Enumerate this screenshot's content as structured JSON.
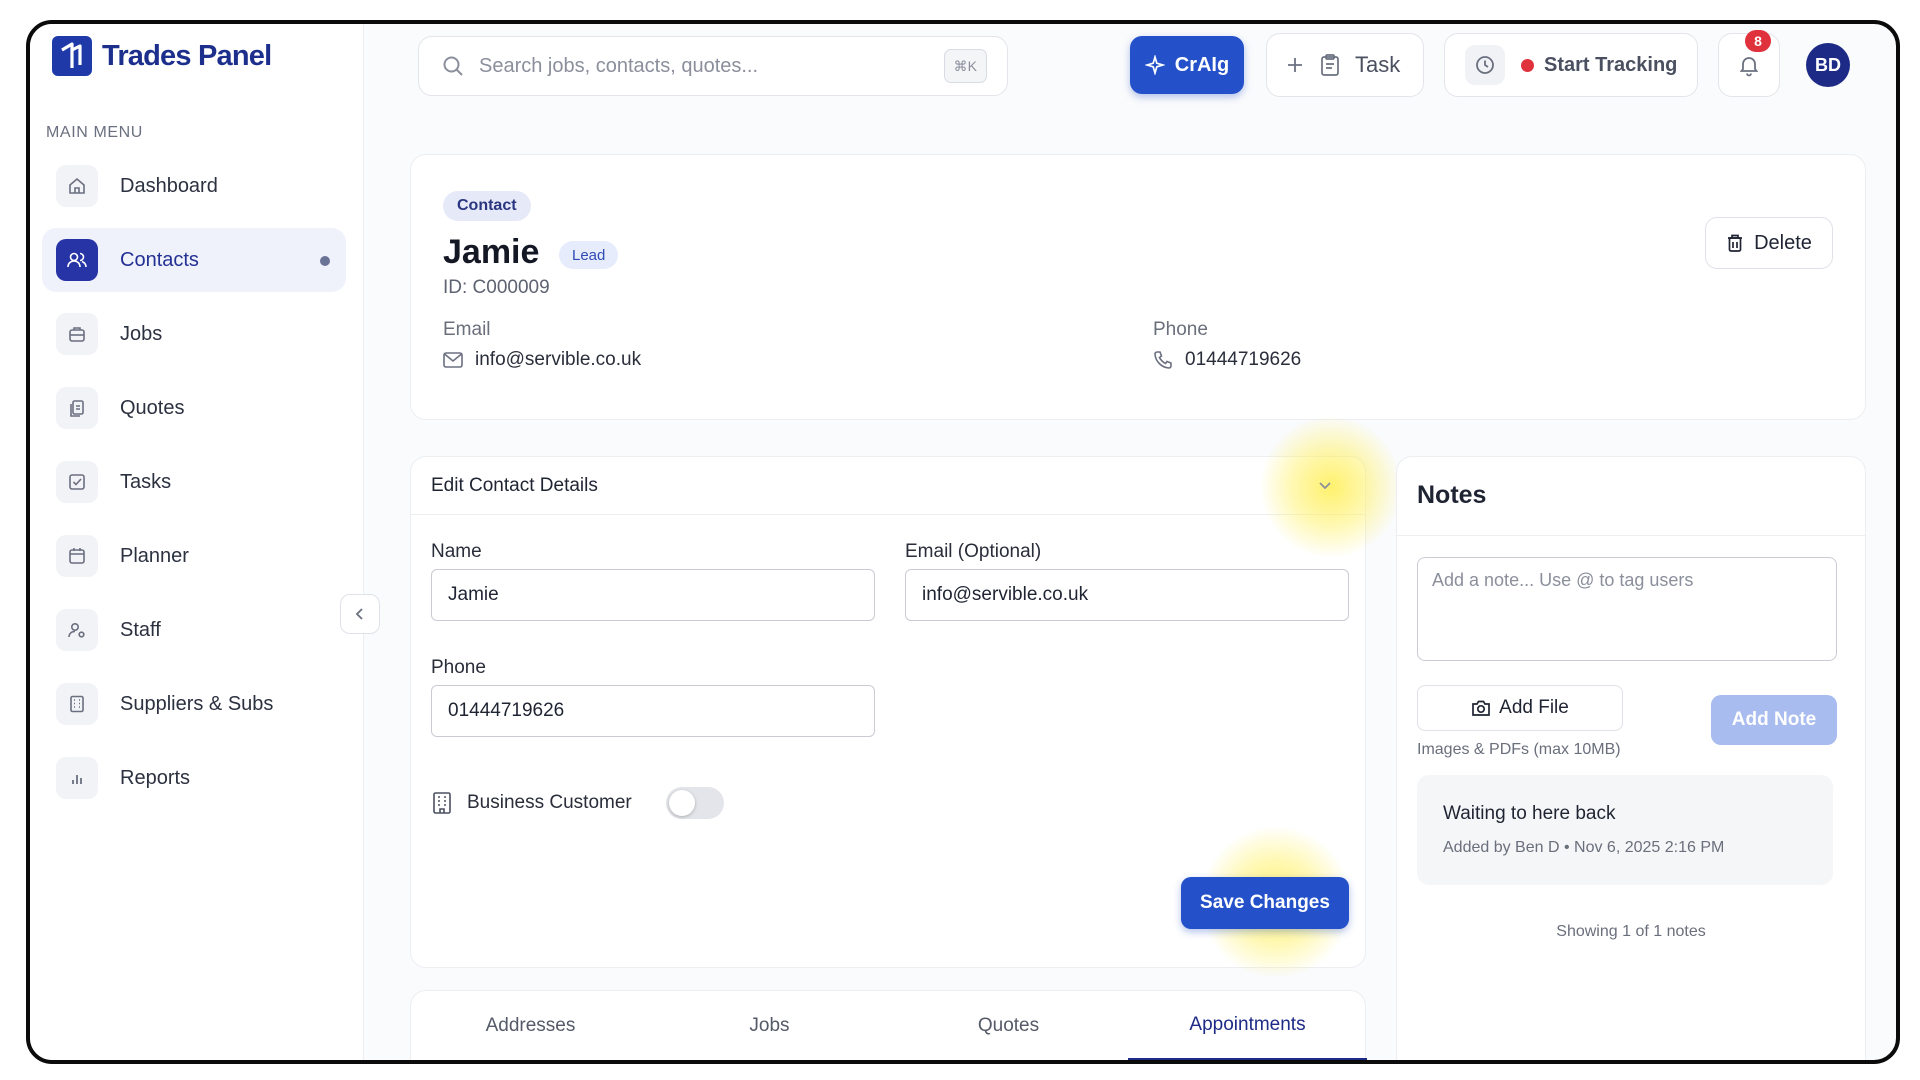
{
  "app": {
    "name": "Trades Panel"
  },
  "sidebar": {
    "menu_title": "MAIN MENU",
    "items": [
      {
        "label": "Dashboard",
        "icon": "home-icon",
        "active": false
      },
      {
        "label": "Contacts",
        "icon": "users-icon",
        "active": true
      },
      {
        "label": "Jobs",
        "icon": "briefcase-icon",
        "active": false
      },
      {
        "label": "Quotes",
        "icon": "document-icon",
        "active": false
      },
      {
        "label": "Tasks",
        "icon": "checkbox-icon",
        "active": false
      },
      {
        "label": "Planner",
        "icon": "calendar-icon",
        "active": false
      },
      {
        "label": "Staff",
        "icon": "user-gear-icon",
        "active": false
      },
      {
        "label": "Suppliers & Subs",
        "icon": "building-icon",
        "active": false
      },
      {
        "label": "Reports",
        "icon": "bar-chart-icon",
        "active": false
      }
    ]
  },
  "topbar": {
    "search_placeholder": "Search jobs, contacts, quotes...",
    "search_shortcut": "⌘K",
    "craig_label": "CrAIg",
    "task_label": "Task",
    "tracking_label": "Start Tracking",
    "notification_count": "8",
    "avatar_initials": "BD"
  },
  "contact": {
    "type_badge": "Contact",
    "name": "Jamie",
    "status_badge": "Lead",
    "id_text": "ID: C000009",
    "email_label": "Email",
    "email": "info@servible.co.uk",
    "phone_label": "Phone",
    "phone": "01444719626",
    "delete_label": "Delete"
  },
  "edit_form": {
    "title": "Edit Contact Details",
    "name_label": "Name",
    "name_value": "Jamie",
    "email_label": "Email (Optional)",
    "email_value": "info@servible.co.uk",
    "phone_label": "Phone",
    "phone_value": "01444719626",
    "business_label": "Business Customer",
    "business_customer": false,
    "save_label": "Save Changes"
  },
  "notes": {
    "title": "Notes",
    "input_placeholder": "Add a note... Use @ to tag users",
    "add_file_label": "Add File",
    "file_hint": "Images & PDFs (max 10MB)",
    "add_note_label": "Add Note",
    "items": [
      {
        "text": "Waiting to here back",
        "meta": "Added by Ben D • Nov 6, 2025 2:16 PM"
      }
    ],
    "count_text": "Showing 1 of 1 notes"
  },
  "tabs": [
    {
      "label": "Addresses",
      "active": false
    },
    {
      "label": "Jobs",
      "active": false
    },
    {
      "label": "Quotes",
      "active": false
    },
    {
      "label": "Appointments",
      "active": true
    }
  ],
  "colors": {
    "brand": "#1f3aa8",
    "primary_button": "#2451c9",
    "alert": "#e0323c",
    "highlight": "#ffec3c"
  }
}
